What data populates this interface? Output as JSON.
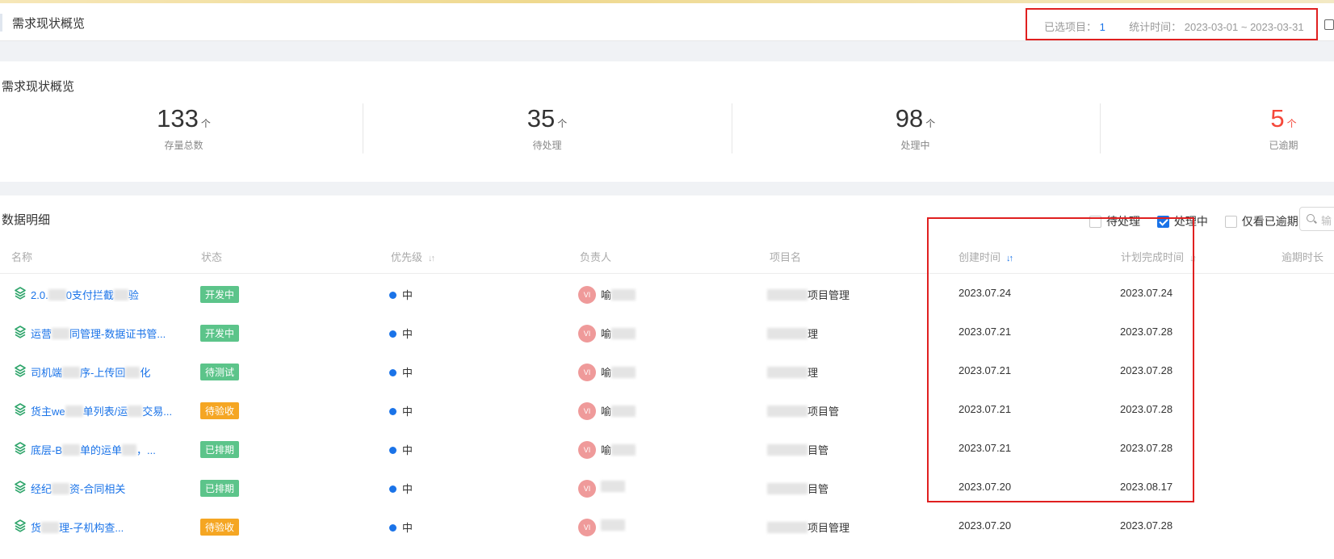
{
  "header": {
    "title": "需求现状概览",
    "selected_label": "已选项目：",
    "selected_count": "1",
    "period_label": "统计时间：",
    "period_value": "2023-03-01 ~ 2023-03-31"
  },
  "overview": {
    "title": "需求现状概览",
    "stats": [
      {
        "value": "133",
        "unit": "个",
        "label": "存量总数"
      },
      {
        "value": "35",
        "unit": "个",
        "label": "待处理"
      },
      {
        "value": "98",
        "unit": "个",
        "label": "处理中"
      },
      {
        "value": "5",
        "unit": "个",
        "label": "已逾期"
      }
    ]
  },
  "detail": {
    "title": "数据明细",
    "filters": [
      {
        "label": "待处理",
        "checked": false
      },
      {
        "label": "处理中",
        "checked": true
      },
      {
        "label": "仅看已逾期",
        "checked": false
      }
    ],
    "search_placeholder": "输",
    "columns": [
      "名称",
      "状态",
      "优先级",
      "负责人",
      "项目名",
      "创建时间",
      "计划完成时间",
      "逾期时长"
    ],
    "rows": [
      {
        "name_a": "2.0.",
        "name_b": "0支付拦截",
        "name_c": "验",
        "status": "开发中",
        "priority": "中",
        "avatar": "VI",
        "owner": "喻",
        "project": "项目管理",
        "created": "2023.07.24",
        "planned": "2023.07.24"
      },
      {
        "name_a": "运营",
        "name_b": "同管理-数据证书管...",
        "name_c": "",
        "status": "开发中",
        "priority": "中",
        "avatar": "VI",
        "owner": "喻",
        "project": "理",
        "created": "2023.07.21",
        "planned": "2023.07.28"
      },
      {
        "name_a": "司机端",
        "name_b": "序-上传回",
        "name_c": "化",
        "status": "待测试",
        "priority": "中",
        "avatar": "VI",
        "owner": "喻",
        "project": "理",
        "created": "2023.07.21",
        "planned": "2023.07.28"
      },
      {
        "name_a": "货主we",
        "name_b": "单列表/运",
        "name_c": "交易...",
        "status": "待验收",
        "priority": "中",
        "avatar": "VI",
        "owner": "喻",
        "project": "项目管",
        "created": "2023.07.21",
        "planned": "2023.07.28"
      },
      {
        "name_a": "底层-B",
        "name_b": "单的运单",
        "name_c": "，...",
        "status": "已排期",
        "priority": "中",
        "avatar": "VI",
        "owner": "喻",
        "project": "目管",
        "created": "2023.07.21",
        "planned": "2023.07.28"
      },
      {
        "name_a": "经纪",
        "name_b": "资-合同相关",
        "name_c": "",
        "status": "已排期",
        "priority": "中",
        "avatar": "VI",
        "owner": "",
        "project": "目管",
        "created": "2023.07.20",
        "planned": "2023.08.17"
      },
      {
        "name_a": "货",
        "name_b": "理-子机构查...",
        "name_c": "",
        "status": "待验收",
        "priority": "中",
        "avatar": "VI",
        "owner": "",
        "project": "项目管理",
        "created": "2023.07.20",
        "planned": "2023.07.28"
      }
    ]
  },
  "colors": {
    "accent": "#1a73e8",
    "overdue": "#f5483a",
    "highlight_box": "#e02020",
    "status_green": "#5cc48a",
    "status_orange": "#f5a623"
  }
}
